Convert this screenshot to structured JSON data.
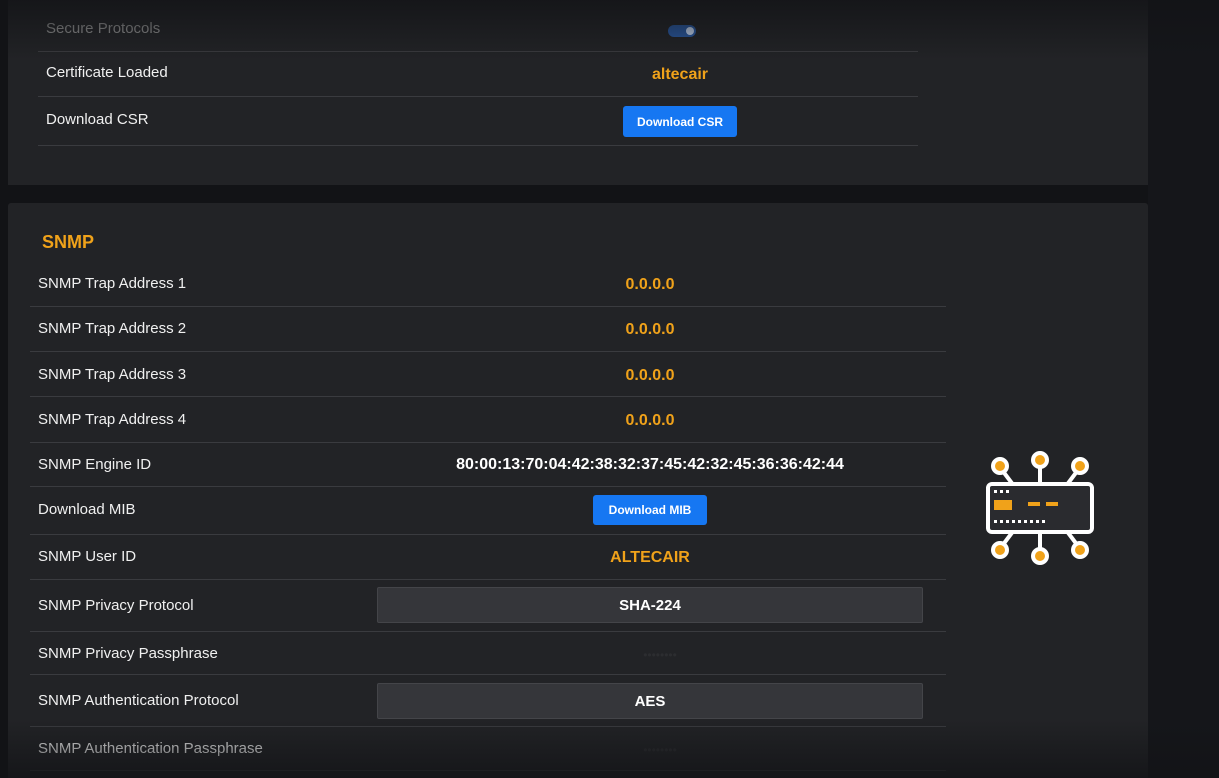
{
  "certificate_section": {
    "rows": [
      {
        "label": "Secure Protocols",
        "toggle_on": true
      },
      {
        "label": "Certificate Loaded",
        "value": "altecair"
      },
      {
        "label": "Download CSR",
        "button": "Download CSR"
      }
    ]
  },
  "snmp": {
    "title": "SNMP",
    "trap1": {
      "label": "SNMP Trap Address 1",
      "value": "0.0.0.0"
    },
    "trap2": {
      "label": "SNMP Trap Address 2",
      "value": "0.0.0.0"
    },
    "trap3": {
      "label": "SNMP Trap Address 3",
      "value": "0.0.0.0"
    },
    "trap4": {
      "label": "SNMP Trap Address 4",
      "value": "0.0.0.0"
    },
    "engine_id": {
      "label": "SNMP Engine ID",
      "value": "80:00:13:70:04:42:38:32:37:45:42:32:45:36:36:42:44"
    },
    "download_mib": {
      "label": "Download MIB",
      "button": "Download MIB"
    },
    "user_id": {
      "label": "SNMP User ID",
      "value": "ALTECAIR"
    },
    "privacy_protocol": {
      "label": "SNMP Privacy Protocol",
      "value": "SHA-224"
    },
    "privacy_passphrase": {
      "label": "SNMP Privacy Passphrase",
      "value": "••••••••"
    },
    "auth_protocol": {
      "label": "SNMP Authentication Protocol",
      "value": "AES"
    },
    "auth_passphrase": {
      "label": "SNMP Authentication Passphrase",
      "value": "••••••••"
    }
  },
  "icon": {
    "name": "network-hub-icon"
  },
  "colors": {
    "accent": "#f0a21a",
    "button": "#1677f2",
    "panel": "#222326",
    "background": "#121316"
  }
}
